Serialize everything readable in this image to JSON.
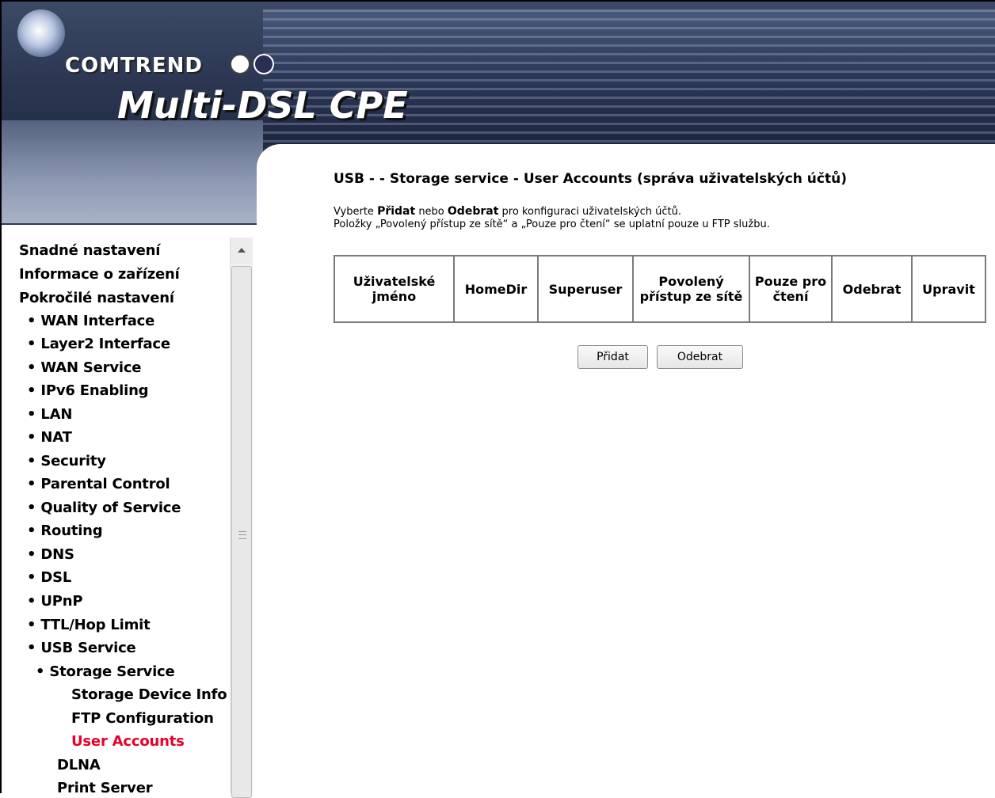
{
  "banner": {
    "brand": "COMTREND",
    "product": "Multi-DSL CPE"
  },
  "nav": {
    "top_items": [
      {
        "label": "Snadné nastavení"
      },
      {
        "label": "Informace o zařízení"
      },
      {
        "label": "Pokročilé nastavení"
      }
    ],
    "advanced_items": [
      {
        "label": "• WAN Interface"
      },
      {
        "label": "• Layer2 Interface"
      },
      {
        "label": "• WAN Service"
      },
      {
        "label": "• IPv6 Enabling"
      },
      {
        "label": "• LAN"
      },
      {
        "label": "• NAT"
      },
      {
        "label": "• Security"
      },
      {
        "label": "• Parental Control"
      },
      {
        "label": "• Quality of Service"
      },
      {
        "label": "• Routing"
      },
      {
        "label": "• DNS"
      },
      {
        "label": "• DSL"
      },
      {
        "label": "• UPnP"
      },
      {
        "label": "• TTL/Hop Limit"
      },
      {
        "label": "• USB Service"
      }
    ],
    "storage_service": "• Storage Service",
    "storage_items": [
      {
        "label": "Storage Device Info"
      },
      {
        "label": "FTP Configuration"
      },
      {
        "label": "User Accounts",
        "active": true
      }
    ],
    "usb_items": [
      {
        "label": "DLNA"
      },
      {
        "label": "Print Server"
      }
    ]
  },
  "main": {
    "title": "USB - - Storage service - User Accounts (správa uživatelských účtů)",
    "desc_line1_pre": "Vyberte ",
    "desc_line1_b1": "Přidat",
    "desc_line1_mid": " nebo ",
    "desc_line1_b2": "Odebrat",
    "desc_line1_post": " pro konfiguraci uživatelských účtů.",
    "desc_line2": "Položky „Povolený přístup ze sítě“ a „Pouze pro čtení“ se uplatní pouze u FTP službu.",
    "table_headers": [
      "Uživatelské jméno",
      "HomeDir",
      "Superuser",
      "Povolený přístup ze sítě",
      "Pouze pro čtení",
      "Odebrat",
      "Upravit"
    ],
    "add_button": "Přidat",
    "remove_button": "Odebrat"
  },
  "colors": {
    "active_link": "#e8002a",
    "table_border": "#7a7a7a"
  }
}
